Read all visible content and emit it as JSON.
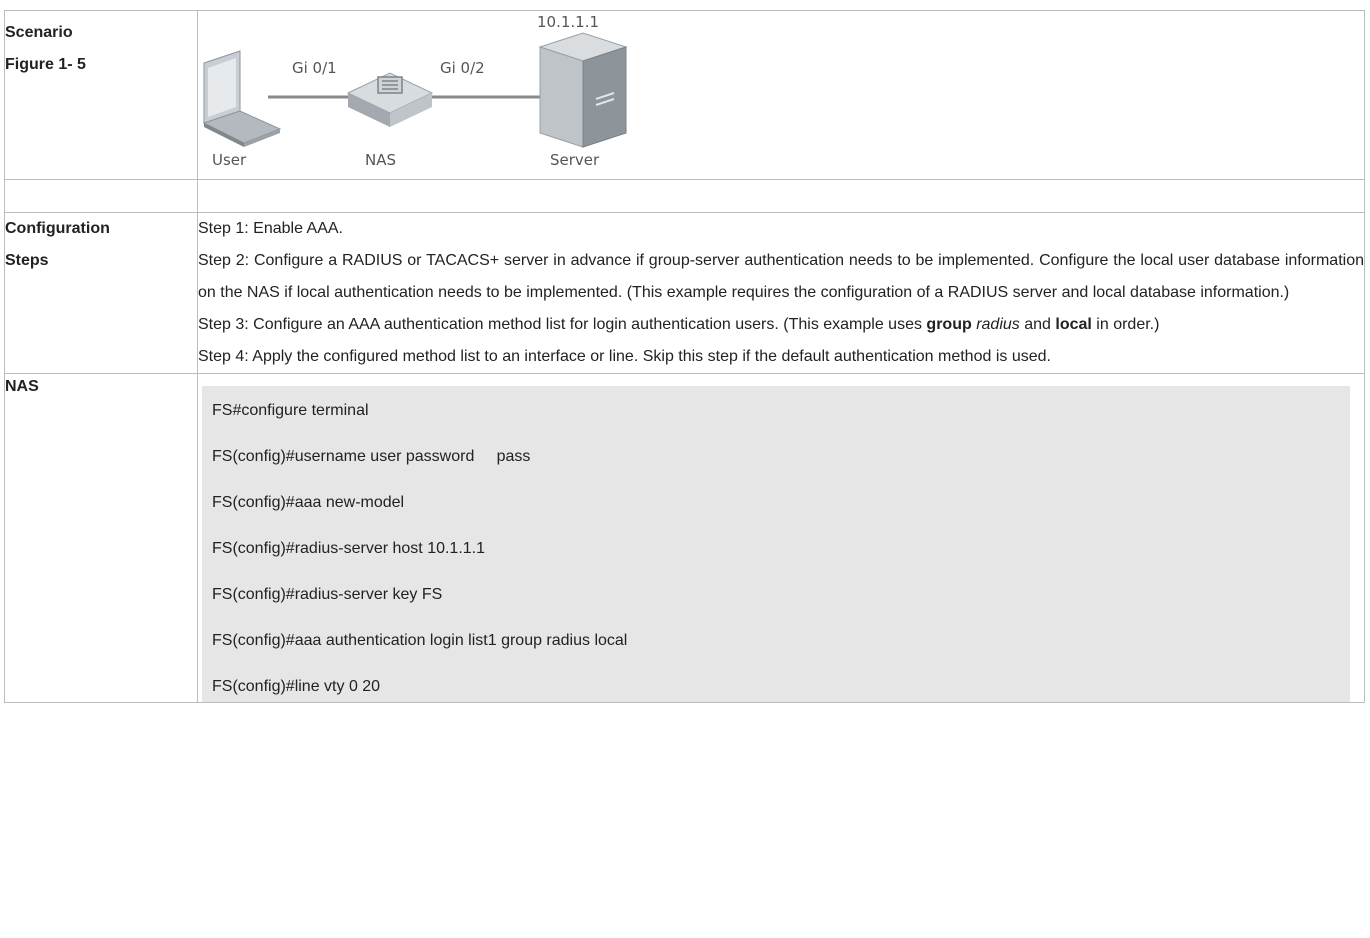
{
  "rows": {
    "scenario": {
      "label_line1": "Scenario",
      "label_line2": "Figure 1- 5",
      "figure": {
        "server_ip": "10.1.1.1",
        "port_left": "Gi 0/1",
        "port_right": "Gi 0/2",
        "user_label": "User",
        "nas_label": "NAS",
        "server_label": "Server"
      }
    },
    "config": {
      "label_line1": "Configuration",
      "label_line2": "Steps",
      "step1": "Step 1: Enable AAA.",
      "step2": "Step 2: Configure a RADIUS or TACACS+ server in advance if group-server authentication needs to be implemented. Configure the local user database information on the NAS if local authentication needs to be implemented. (This example requires the configuration of a RADIUS server and local database information.)",
      "step3_a": "Step 3: Configure an AAA authentication method list for login authentication users. (This example uses ",
      "step3_b": "group",
      "step3_c": "radius",
      "step3_d": "and",
      "step3_e": "local",
      "step3_f": " in order.)",
      "step4": "Step 4: Apply the configured method list to an interface or line. Skip this step if the default authentication method is used."
    },
    "nas": {
      "label": "NAS",
      "commands": [
        "FS#configure terminal",
        "FS(config)#username user password     pass",
        "FS(config)#aaa new-model",
        "FS(config)#radius-server host 10.1.1.1",
        "FS(config)#radius-server key FS",
        "FS(config)#aaa authentication login list1 group radius local",
        "FS(config)#line vty 0 20"
      ]
    }
  },
  "colors": {
    "border": "#bdbdbd",
    "code_bg": "#e6e6e6"
  }
}
